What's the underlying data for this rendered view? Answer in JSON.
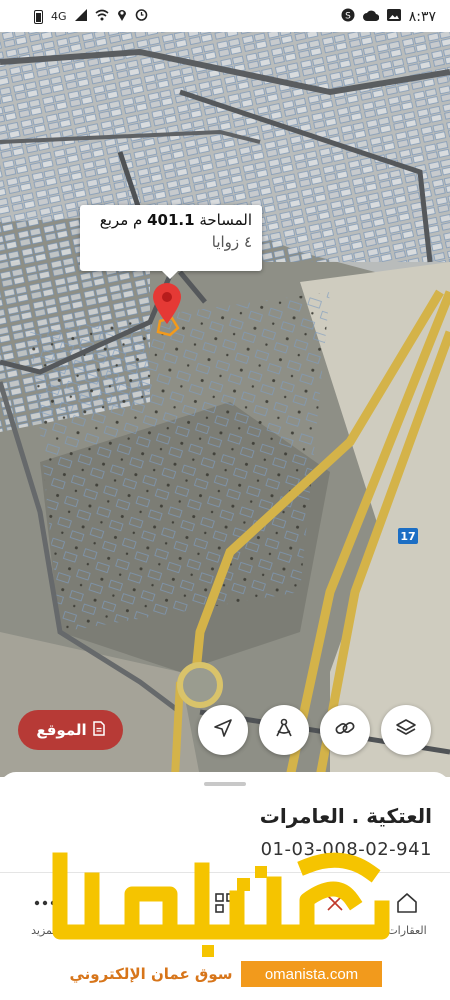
{
  "status_bar": {
    "network": "4G",
    "time": "٨:٣٧"
  },
  "map": {
    "highway_shield": "17",
    "popup": {
      "area_label": "المساحة",
      "area_value": "401.1",
      "area_unit": "م مربع",
      "corners": "٤ زوايا"
    },
    "location_button": {
      "label": "الموقع",
      "icon": "document-icon"
    },
    "controls": [
      {
        "name": "navigate-button",
        "icon": "navigation-arrow-icon"
      },
      {
        "name": "measure-button",
        "icon": "compass-measure-icon"
      },
      {
        "name": "link-button",
        "icon": "link-icon"
      },
      {
        "name": "layers-button",
        "icon": "layers-icon"
      }
    ]
  },
  "sheet": {
    "title": "العتكية . العامرات",
    "parcel_id": "01-03-008-02-941"
  },
  "nav": {
    "items": [
      {
        "label": "العقارات",
        "icon": "home-icon"
      },
      {
        "label": "المزيد",
        "icon": "more-dots-icon"
      }
    ]
  },
  "watermark": {
    "brand": "عمانيستا",
    "domain": "omanista.com",
    "tagline": "سوق عمان الإلكتروني",
    "color": "#f5c400"
  }
}
